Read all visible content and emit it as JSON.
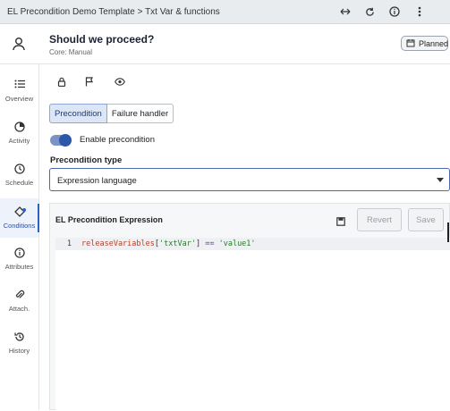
{
  "topbar": {
    "title": "EL Precondition Demo Template > Txt Var & functions",
    "icons": [
      "resize-horizontal-icon",
      "refresh-icon",
      "info-icon",
      "more-vertical-icon"
    ]
  },
  "header": {
    "title": "Should we proceed?",
    "subtitle": "Core: Manual",
    "badge": "Planned"
  },
  "sidenav": {
    "items": [
      {
        "label": "Overview",
        "icon": "list-icon"
      },
      {
        "label": "Activity",
        "icon": "activity-icon"
      },
      {
        "label": "Schedule",
        "icon": "clock-icon"
      },
      {
        "label": "Conditions",
        "icon": "conditions-icon"
      },
      {
        "label": "Attributes",
        "icon": "info-icon"
      },
      {
        "label": "Attach.",
        "icon": "paperclip-icon"
      },
      {
        "label": "History",
        "icon": "history-icon"
      }
    ],
    "active": "Conditions"
  },
  "toolbar_icons": [
    "lock-icon",
    "flag-icon",
    "eye-icon"
  ],
  "tabs": {
    "precondition": "Precondition",
    "failure": "Failure handler"
  },
  "toggle": {
    "label": "Enable precondition",
    "on": true
  },
  "precondition_type": {
    "label": "Precondition type",
    "value": "Expression language"
  },
  "expression": {
    "title": "EL Precondition Expression",
    "revert": "Revert",
    "save": "Save",
    "line_number": "1",
    "code": {
      "fn": "releaseVariables",
      "open": "[",
      "key": "'txtVar'",
      "close": "]",
      "op": "==",
      "value": "'value1'"
    }
  },
  "colors": {
    "accent": "#2a62c8",
    "toggle": "#2c58a8"
  }
}
